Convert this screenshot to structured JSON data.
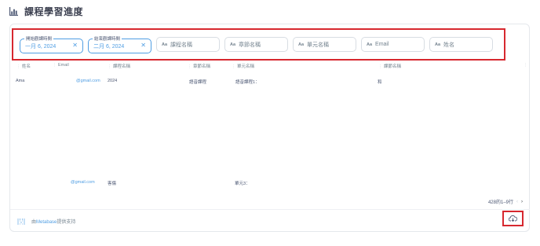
{
  "page": {
    "title": "課程學習進度"
  },
  "filters": {
    "start_date": {
      "legend": "開始觀課時間",
      "value": "一月 6, 2024"
    },
    "end_date": {
      "legend": "結束觀課時間",
      "value": "二月 6, 2024"
    },
    "text_filters": [
      {
        "aa": "Aa",
        "placeholder": "課程名稱"
      },
      {
        "aa": "Aa",
        "placeholder": "章節名稱"
      },
      {
        "aa": "Aa",
        "placeholder": "單元名稱"
      },
      {
        "aa": "Aa",
        "placeholder": "Email"
      },
      {
        "aa": "Aa",
        "placeholder": "姓名"
      }
    ]
  },
  "table": {
    "headers": [
      "姓名",
      "Email",
      "課程名稱",
      "章節名稱",
      "單元名稱",
      "課節名稱"
    ],
    "row1": {
      "name": "Ama",
      "email": "@gmail.com",
      "course": "2024",
      "chapter": "語音課程",
      "unit": "語音課程1：",
      "lesson": "和"
    },
    "row2": {
      "email": "@gmail.com",
      "course": "客傷",
      "unit": "單元3："
    }
  },
  "pagination": {
    "label": "428的1–9行",
    "prev": "‹",
    "next": "›"
  },
  "footer": {
    "prefix": "由",
    "brand": "Metabase",
    "suffix": "提供支持"
  },
  "icons": {
    "chart": "bar-chart-icon",
    "clear": "close-icon",
    "download": "cloud-download-icon",
    "logo": "metabase-logo"
  },
  "colors": {
    "accent": "#509ee3",
    "highlight": "#d7282f"
  }
}
